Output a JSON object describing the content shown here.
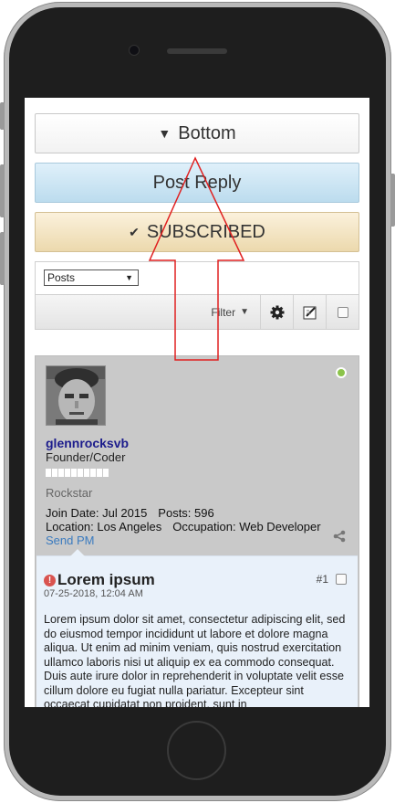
{
  "device": {
    "frame_color": "#b9b9b9",
    "bezel_color": "#1e1e1e"
  },
  "actions": {
    "bottom_label": "Bottom",
    "bottom_icon": "triangle-down-icon",
    "reply_label": "Post Reply",
    "subscribed_label": "SUBSCRIBED",
    "subscribed_icon": "checkmark-icon"
  },
  "toolbar": {
    "posts_select_value": "Posts",
    "filter_label": "Filter",
    "icons": [
      "gear-icon",
      "edit-icon",
      "select-all-checkbox"
    ]
  },
  "post": {
    "username": "glennrocksvb",
    "user_title": "Founder/Coder",
    "rank": "Rockstar",
    "join_date_label": "Join Date: Jul 2015",
    "posts_label": "Posts: 596",
    "location_label": "Location: Los Angeles",
    "occupation_label": "Occupation: Web Developer",
    "send_pm": "Send PM",
    "online_status_color": "#8bc34a",
    "title": "Lorem ipsum",
    "date": "07-25-2018, 12:04 AM",
    "number": "#1",
    "body": "Lorem ipsum dolor sit amet, consectetur adipiscing elit, sed do eiusmod tempor incididunt ut labore et dolore magna aliqua. Ut enim ad minim veniam, quis nostrud exercitation ullamco laboris nisi ut aliquip ex ea commodo consequat. Duis aute irure dolor in reprehenderit in voluptate velit esse cillum dolore eu fugiat nulla pariatur. Excepteur sint occaecat cupidatat non proident, sunt in"
  },
  "annotation": {
    "arrow_color": "#e02020"
  }
}
